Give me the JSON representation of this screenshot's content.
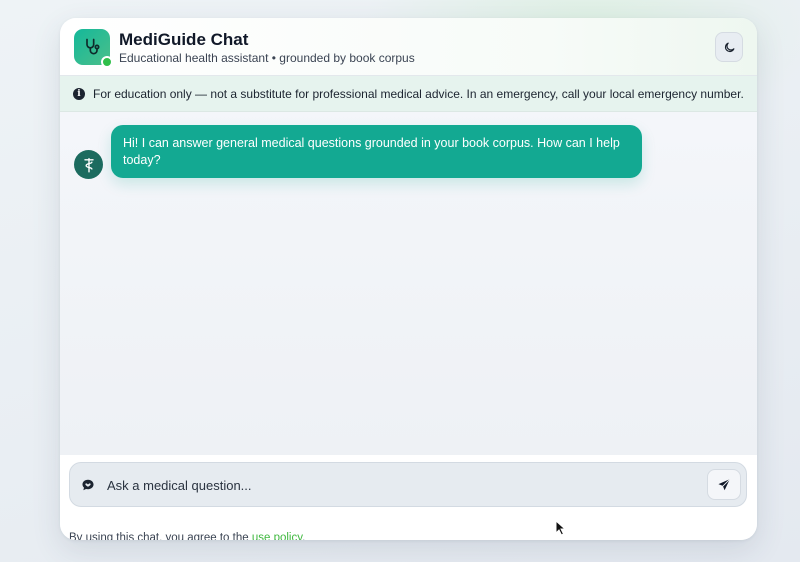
{
  "header": {
    "title": "MediGuide Chat",
    "subtitle": "Educational health assistant • grounded by book corpus",
    "logo_icon": "stethoscope-icon",
    "theme_toggle_icon": "moon-icon",
    "status": "online"
  },
  "notice": {
    "icon": "info-icon",
    "text": "For education only — not a substitute for professional medical advice. In an emergency, call your local emergency number."
  },
  "messages": [
    {
      "role": "assistant",
      "avatar_icon": "caduceus-icon",
      "text": "Hi! I can answer general medical questions grounded in your book corpus. How can I help today?"
    }
  ],
  "composer": {
    "icon": "chat-bubble-icon",
    "placeholder": "Ask a medical question...",
    "value": "",
    "send_icon": "send-icon"
  },
  "footer": {
    "policy_prefix": "By using this chat, you agree to the ",
    "policy_link": "use policy",
    "policy_suffix": "."
  },
  "colors": {
    "accent": "#13a992",
    "logo_gradient_start": "#14b89a",
    "logo_gradient_end": "#4bbf8a",
    "status_online": "#2fbf4a",
    "notice_bg": "#e6f3ee",
    "avatar_bg": "#1c6b5f",
    "link": "#3fb83f"
  }
}
